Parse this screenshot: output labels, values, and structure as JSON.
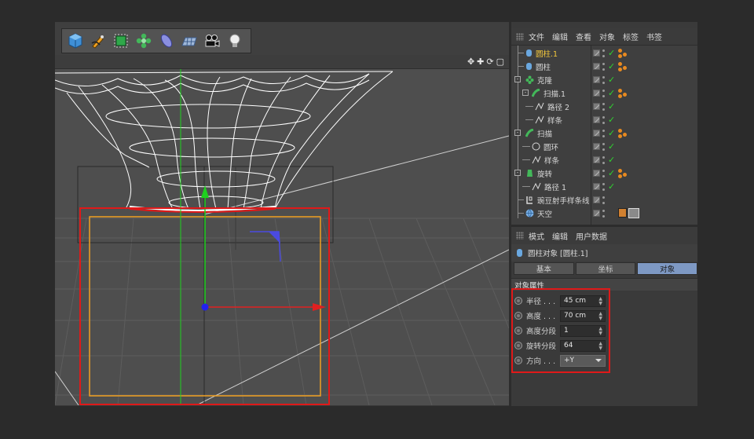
{
  "toolbar": {
    "icons": [
      "cube-icon",
      "pen-icon",
      "subdivision-icon",
      "cloner-icon",
      "deformer-icon",
      "floor-icon",
      "camera-icon",
      "light-icon"
    ]
  },
  "viewport": {
    "nav_icons": [
      "move-view-icon",
      "zoom-view-icon",
      "rotate-view-icon",
      "maximize-view-icon"
    ],
    "nav_glyphs": [
      "✥",
      "✚",
      "⟳",
      "▢"
    ]
  },
  "object_manager": {
    "menu": [
      "文件",
      "编辑",
      "查看",
      "对象",
      "标签",
      "书签"
    ],
    "rows": [
      {
        "label": "圆柱.1",
        "icon": "cylinder-icon",
        "selected": true,
        "tags": true
      },
      {
        "label": "圆柱",
        "icon": "cylinder-icon",
        "selected": false,
        "tags": true
      },
      {
        "label": "克隆",
        "icon": "cloner-icon",
        "selected": false,
        "tags": false
      },
      {
        "label": "扫描.1",
        "icon": "sweep-icon",
        "selected": false,
        "tags": true
      },
      {
        "label": "路径 2",
        "icon": "spline-icon",
        "selected": false,
        "tags": false
      },
      {
        "label": "样条",
        "icon": "spline-icon",
        "selected": false,
        "tags": false
      },
      {
        "label": "扫描",
        "icon": "sweep-icon",
        "selected": false,
        "tags": true
      },
      {
        "label": "圆环",
        "icon": "circle-icon",
        "selected": false,
        "tags": false
      },
      {
        "label": "样条",
        "icon": "spline-icon",
        "selected": false,
        "tags": false
      },
      {
        "label": "旋转",
        "icon": "lathe-icon",
        "selected": false,
        "tags": true
      },
      {
        "label": "路径 1",
        "icon": "spline-icon",
        "selected": false,
        "tags": false
      },
      {
        "label": "豌豆射手样条线",
        "icon": "null-icon",
        "selected": false,
        "tags": false
      },
      {
        "label": "天空",
        "icon": "sky-icon",
        "selected": false,
        "tags": false
      }
    ]
  },
  "attribute_manager": {
    "menu": [
      "模式",
      "编辑",
      "用户数据"
    ],
    "object_title": "圆柱对象 [圆柱.1]",
    "tabs": [
      "基本",
      "坐标",
      "对象"
    ],
    "active_tab": "对象",
    "section": "对象属性",
    "properties": [
      {
        "label": "半径 . . .",
        "value": "45 cm",
        "kind": "number"
      },
      {
        "label": "高度 . . .",
        "value": "70 cm",
        "kind": "number"
      },
      {
        "label": "高度分段",
        "value": "1",
        "kind": "number"
      },
      {
        "label": "旋转分段",
        "value": "64",
        "kind": "number"
      },
      {
        "label": "方向 . . .",
        "value": "+Y",
        "kind": "select"
      }
    ]
  },
  "colors": {
    "highlight_box": "#e01919",
    "selected_object": "#f4c83c",
    "active_tab": "#7e99c4",
    "axis_x": "#e02020",
    "axis_y": "#1fd11f",
    "axis_z": "#2222ee",
    "bounding_box": "#f0a020"
  }
}
